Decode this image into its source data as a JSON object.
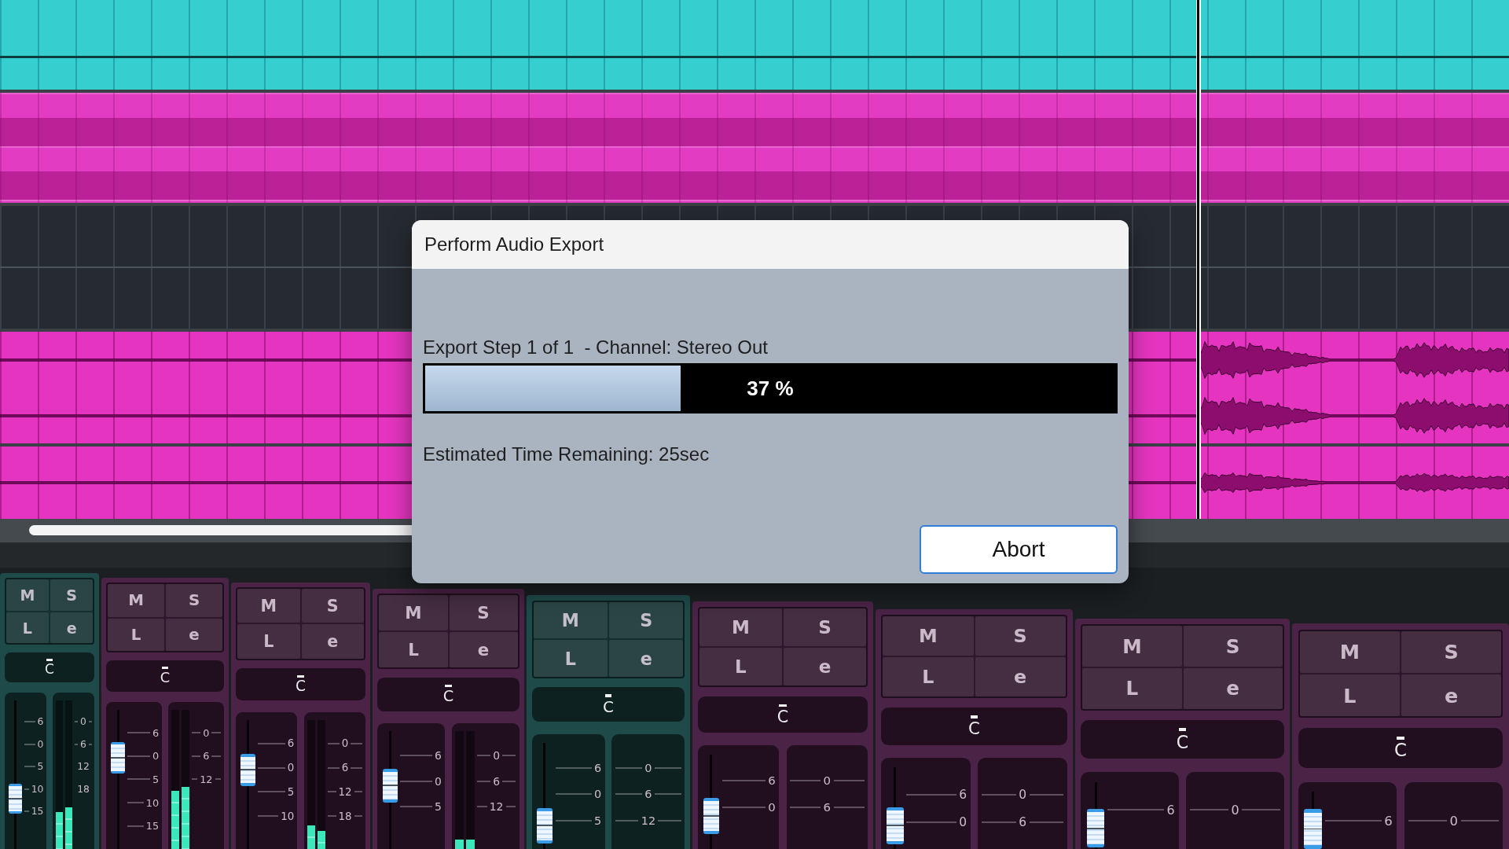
{
  "arrangement": {
    "lanes": [
      {
        "kind": "line",
        "color": "#35cfd0"
      },
      {
        "kind": "stack",
        "color": "#e23cc2"
      },
      {
        "kind": "empty"
      },
      {
        "kind": "audio",
        "color": "#e535c0",
        "stereo": true
      },
      {
        "kind": "audio",
        "color": "#e535c0",
        "stereo": false
      }
    ]
  },
  "dialog": {
    "title": "Perform Audio Export",
    "step": "Export Step 1 of 1  - Channel: Stereo Out",
    "progress": {
      "level": 0.37,
      "reading": "37 %"
    },
    "estimate": "Estimated Time Remaining: 25sec",
    "button": "Abort"
  },
  "mixer": {
    "strips": [
      {
        "color": "#1e4a4a",
        "buttons": [
          "M",
          "S",
          "L",
          "e"
        ],
        "pan": "C",
        "fader": {
          "level": 0.3,
          "scale": [
            "6",
            "0",
            "5",
            "10",
            "15"
          ]
        },
        "meter": {
          "scale": [
            "0",
            "6",
            "12",
            "18"
          ],
          "channels": [
            {
              "level": 0.25
            },
            {
              "level": 0.28
            }
          ]
        }
      },
      {
        "color": "#4a2346",
        "buttons": [
          "M",
          "S",
          "L",
          "e"
        ],
        "pan": "C",
        "fader": {
          "level": 0.7,
          "scale": [
            "6",
            "0",
            "5",
            "10",
            "15"
          ]
        },
        "meter": {
          "scale": [
            "0",
            "6",
            "12"
          ],
          "channels": [
            {
              "level": 0.42
            },
            {
              "level": 0.45
            }
          ]
        }
      },
      {
        "color": "#4a2346",
        "buttons": [
          "M",
          "S",
          "L",
          "e"
        ],
        "pan": "C",
        "fader": {
          "level": 0.65,
          "scale": [
            "6",
            "0",
            "5",
            "10"
          ]
        },
        "meter": {
          "scale": [
            "0",
            "6",
            "12",
            "18"
          ],
          "channels": [
            {
              "level": 0.18
            },
            {
              "level": 0.14
            }
          ]
        }
      },
      {
        "color": "#4a2346",
        "buttons": [
          "M",
          "S",
          "L",
          "e"
        ],
        "pan": "C",
        "fader": {
          "level": 0.55,
          "scale": [
            "6",
            "0",
            "5"
          ]
        },
        "meter": {
          "scale": [
            "0",
            "6",
            "12"
          ],
          "channels": [
            {
              "level": 0.08
            },
            {
              "level": 0.08
            }
          ]
        }
      },
      {
        "color": "#1e4a4a",
        "buttons": [
          "M",
          "S",
          "L",
          "e"
        ],
        "pan": "C",
        "fader": {
          "level": 0.08,
          "scale": [
            "6",
            "0",
            "5"
          ]
        },
        "meter": {
          "scale": [
            "0",
            "6",
            "12"
          ]
        }
      },
      {
        "color": "#4a2346",
        "buttons": [
          "M",
          "S",
          "L",
          "e"
        ],
        "pan": "C",
        "fader": {
          "level": 0.25,
          "scale": [
            "6",
            "0"
          ]
        },
        "meter": {
          "scale": [
            "0",
            "6"
          ]
        }
      },
      {
        "color": "#4a2346",
        "buttons": [
          "M",
          "S",
          "L",
          "e"
        ],
        "pan": "C",
        "fader": {
          "level": 0.1,
          "scale": [
            "6",
            "0"
          ]
        },
        "meter": {
          "scale": [
            "0",
            "6"
          ]
        }
      },
      {
        "color": "#4a2346",
        "buttons": [
          "M",
          "S",
          "L",
          "e"
        ],
        "pan": "C",
        "fader": {
          "level": 0.05,
          "scale": [
            "6"
          ]
        },
        "meter": {
          "scale": [
            "0"
          ]
        }
      },
      {
        "color": "#4a2346",
        "buttons": [
          "M",
          "S",
          "L",
          "e"
        ],
        "pan": "C",
        "fader": {
          "level": 0,
          "scale": [
            "6"
          ]
        },
        "meter": {
          "scale": [
            "0"
          ]
        }
      }
    ]
  }
}
